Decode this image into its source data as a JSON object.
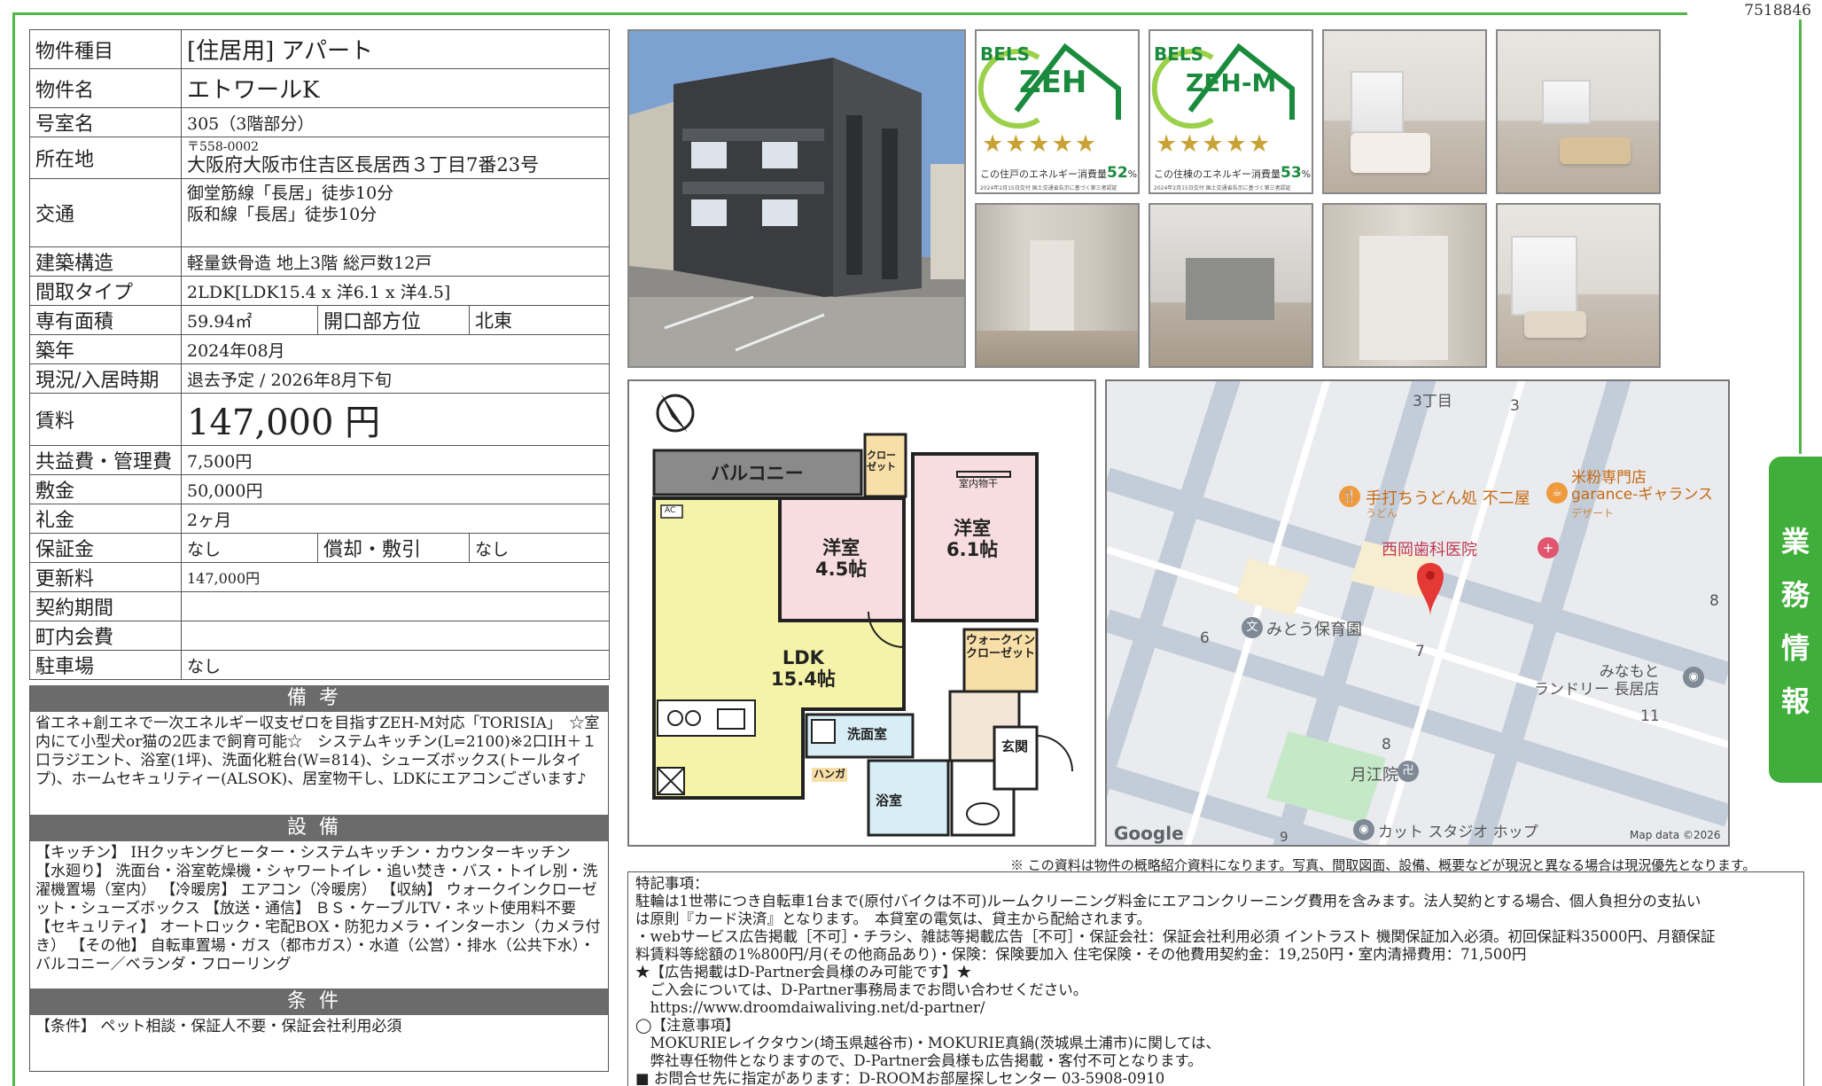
{
  "doc_id": "7518846",
  "side_tab": [
    "業",
    "務",
    "情",
    "報"
  ],
  "property": {
    "type_label": "物件種目",
    "type_value": "[住居用] アパート",
    "name_label": "物件名",
    "name_value": "エトワールK",
    "room_label": "号室名",
    "room_value": "305（3階部分）",
    "address_label": "所在地",
    "zip": "〒558-0002",
    "address": "大阪府大阪市住吉区長居西３丁目7番23号",
    "transit_label": "交通",
    "transit_1": "御堂筋線「長居」徒歩10分",
    "transit_2": "阪和線「長居」徒歩10分",
    "structure_label": "建築構造",
    "structure_value": "軽量鉄骨造 地上3階 総戸数12戸",
    "layout_label": "間取タイプ",
    "layout_value": "2LDK[LDK15.4 x 洋6.1 x 洋4.5]",
    "area_label": "専有面積",
    "area_value": "59.94㎡",
    "direction_label": "開口部方位",
    "direction_value": "北東",
    "built_label": "築年",
    "built_value": "2024年08月",
    "status_label": "現況/入居時期",
    "status_value": "退去予定 / 2026年8月下旬",
    "rent_label": "賃料",
    "rent_value": "147,000 円",
    "fee_label": "共益費・管理費",
    "fee_value": "7,500円",
    "deposit_label": "敷金",
    "deposit_value": "50,000円",
    "keymoney_label": "礼金",
    "keymoney_value": "2ヶ月",
    "guarantee_label": "保証金",
    "guarantee_value": "なし",
    "amort_label": "償却・敷引",
    "amort_value": "なし",
    "renewal_label": "更新料",
    "renewal_value": "147,000円",
    "contract_label": "契約期間",
    "contract_value": "",
    "community_label": "町内会費",
    "community_value": "",
    "parking_label": "駐車場",
    "parking_value": "なし"
  },
  "notes": {
    "remarks_head": "備考",
    "remarks_body": "省エネ+創エネで一次エネルギー収支ゼロを目指すZEH-M対応「TORISIA」　☆室内にて小型犬or猫の2匹まで飼育可能☆　システムキッチン(L=2100)※2口IH＋１口ラジエント、浴室(1坪)、洗面化粧台(W=814)、シューズボックス(トールタイプ)、ホームセキュリティー(ALSOK)、居室物干し、LDKにエアコンございます♪",
    "equipment_head": "設備",
    "equipment_body": "【キッチン】 IHクッキングヒーター・システムキッチン・カウンターキッチン 【水廻り】 洗面台・浴室乾燥機・シャワートイレ・追い焚き・バス・トイレ別・洗濯機置場（室内） 【冷暖房】 エアコン（冷暖房） 【収納】 ウォークインクローゼット・シューズボックス 【放送・通信】 ＢＳ・ケーブルTV・ネット使用料不要 【セキュリティ】 オートロック・宅配BOX・防犯カメラ・インターホン（カメラ付き） 【その他】 自転車置場・ガス（都市ガス）・水道（公営）・排水（公共下水）・バルコニー／ベランダ・フローリング",
    "conditions_head": "条件",
    "conditions_body": "【条件】 ペット相談・保証人不要・保証会社利用必須"
  },
  "bels": [
    {
      "brand": "BELS",
      "mark": "ZEH",
      "stars": "★★★★★",
      "pct_pre": "この住戸のエネルギー消費量",
      "pct": "52",
      "pct_post": "%削減",
      "fine": "2024年2月15日交付 国土交通省告示に基づく第三者認証"
    },
    {
      "brand": "BELS",
      "mark": "ZEH-M",
      "stars": "★★★★★",
      "pct_pre": "この住棟のエネルギー消費量",
      "pct": "53",
      "pct_post": "%削減",
      "fine": "2024年2月15日交付 国土交通省告示に基づく第三者認証"
    }
  ],
  "plan": {
    "balcony": "バルコニー",
    "closet": "クロー\nゼット",
    "room_a": "洋室\n4.5帖",
    "room_b": "洋室\n6.1帖",
    "drying": "室内物干",
    "ldk": "LDK\n15.4帖",
    "walkin": "ウォークイン\nクローゼット",
    "washroom": "洗面室",
    "entrance": "玄関",
    "bath": "浴室",
    "hanger": "ハンガ",
    "ac": "AC"
  },
  "map": {
    "district_3": "3丁目",
    "n3": "3",
    "n6": "6",
    "n7": "7",
    "n8a": "8",
    "n8b": "8",
    "n9": "9",
    "n11": "11",
    "udon": "手打ちうどん処 不二屋",
    "udon_sub": "うどん",
    "cafe": "米粉専門店\ngarance-ギャランス",
    "cafe_sub": "デザート",
    "dental": "西岡歯科医院",
    "nursery": "みとう保育園",
    "laundry": "みなもと\nランドリー 長居店",
    "temple": "月江院",
    "salon": "カット スタジオ ホップ",
    "google": "Google",
    "mapdata": "Map data ©2026"
  },
  "disclaimer": "※ この資料は物件の概略紹介資料になります。写真、間取図面、設備、概要などが現況と異なる場合は現況優先となります。",
  "remarks": [
    "特記事項：",
    "駐輪は1世帯につき自転車1台まで(原付バイクは不可)ルームクリーニング料金にエアコンクリーニング費用を含みます。法人契約とする場合、個人負担分の支払い",
    "は原則『カード決済』となります。　本貸室の電気は、貸主から配給されます。",
    "・webサービス広告掲載［不可］・チラシ、雑誌等掲載広告［不可］・保証会社：保証会社利用必須 イントラスト 機関保証加入必須。初回保証料35000円、月額保証",
    "料賃料等総額の1%800円/月(その他商品あり)・保険：保険要加入 住宅保険・その他費用契約金：19,250円・室内清掃費用：71,500円",
    "★【広告掲載はD-Partner会員様のみ可能です】★",
    "　ご入会については、D-Partner事務局までお問い合わせください。",
    "　https://www.droomdaiwaliving.net/d-partner/",
    "◯【注意事項】",
    "　MOKURIEレイクタウン(埼玉県越谷市)・MOKURIE真鍋(茨城県土浦市)に関しては、",
    "　弊社専任物件となりますので、D-Partner会員様も広告掲載・客付不可となります。",
    "■ お問合せ先に指定があります：D-ROOMお部屋探しセンター 03-5908-0910"
  ],
  "colors": {
    "accent_green": "#4fb848",
    "tab_green": "#3fae3a",
    "section_gray": "#6b6b6b",
    "ldk_yellow": "#f4f3a8",
    "room_pink": "#f8dde0",
    "closet_orange": "#f8dfa8",
    "wet_blue": "#d8eef6"
  }
}
